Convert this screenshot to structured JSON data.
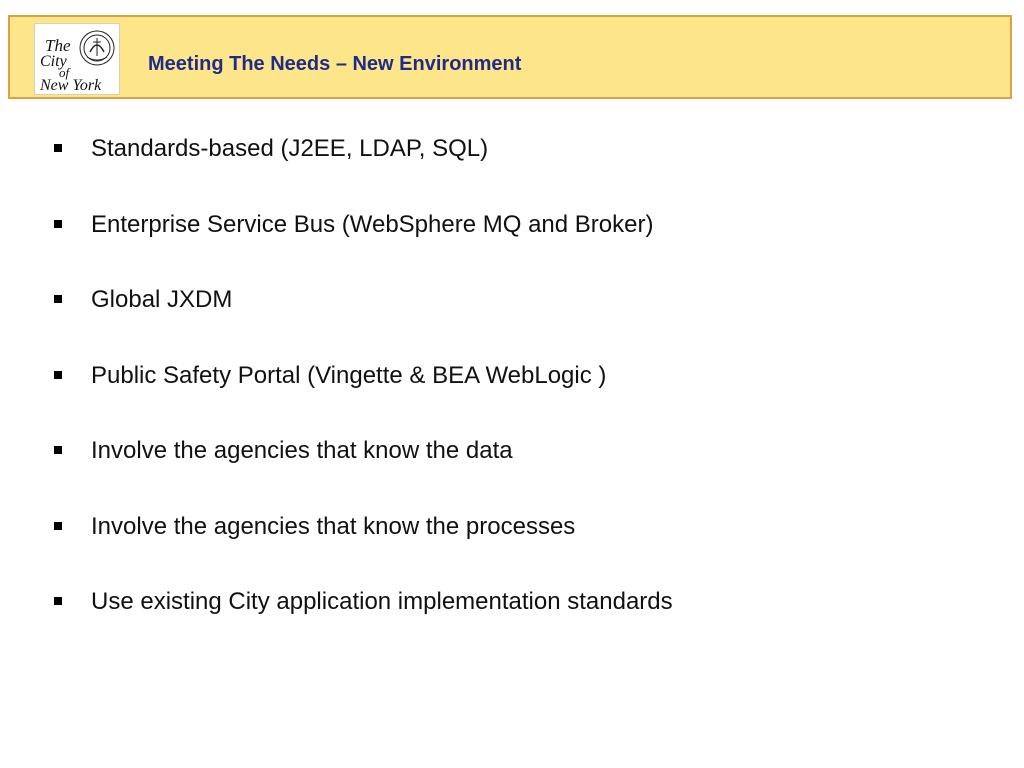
{
  "header": {
    "title": "Meeting The Needs – New Environment",
    "logo": {
      "icon": "city-of-new-york-logo",
      "text": "The City of New York"
    }
  },
  "bullets": [
    "Standards-based (J2EE, LDAP, SQL)",
    "Enterprise Service Bus (WebSphere MQ and Broker)",
    "Global JXDM",
    "Public Safety Portal (Vingette & BEA WebLogic )",
    "Involve the agencies that know the data",
    "Involve the agencies that know the processes",
    "Use existing City application implementation standards"
  ],
  "colors": {
    "header_background": "#fde68a",
    "header_border": "#e0a040",
    "title_text": "#1f2a8a",
    "body_text": "#111111"
  }
}
